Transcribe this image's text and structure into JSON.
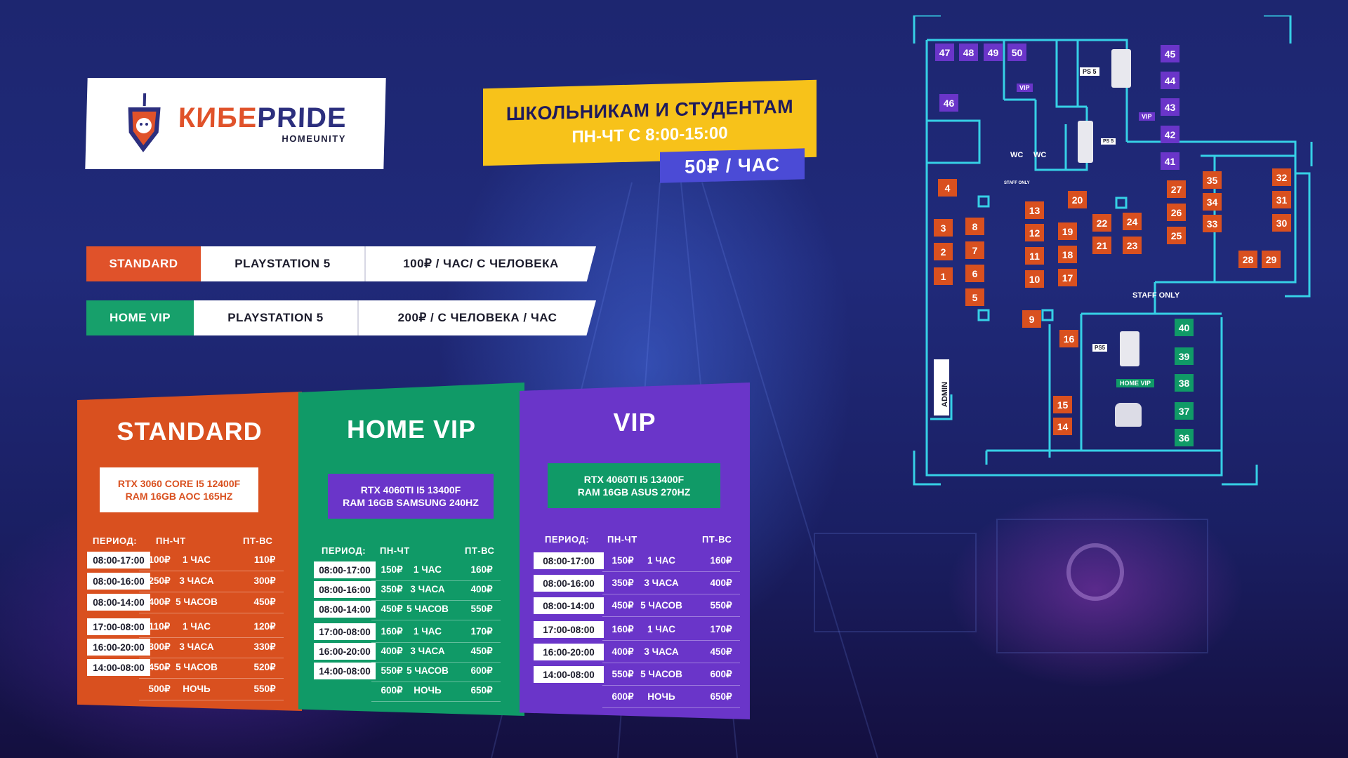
{
  "logo": {
    "name_part1": "КИБЕ",
    "name_part2": "PRIDE",
    "sub": "HOMEUNITY"
  },
  "promo": {
    "title": "ШКОЛЬНИКАМ И СТУДЕНТАМ",
    "subtitle": "ПН-ЧТ С 8:00-15:00",
    "price": "50₽ / ЧАС"
  },
  "playstation": [
    {
      "zone": "STANDARD",
      "device": "PLAYSTATION 5",
      "price": "100₽ / ЧАС/ С ЧЕЛОВЕКА",
      "color": "#e0522a"
    },
    {
      "zone": "HOME VIP",
      "device": "PLAYSTATION 5",
      "price": "200₽ / С ЧЕЛОВЕКА / ЧАС",
      "color": "#17a06b"
    }
  ],
  "headers": {
    "period": "ПЕРИОД:",
    "weekdays": "ПН-ЧТ",
    "weekend": "ПТ-ВС"
  },
  "panels": {
    "standard": {
      "title": "STANDARD",
      "spec1": "RTX 3060 CORE I5 12400F",
      "spec2": "RAM 16GB AOC 165HZ",
      "color": "#d9501f",
      "rows": [
        {
          "time": "08:00-17:00",
          "wd": "100₽",
          "dur": "1 ЧАС",
          "we": "110₽"
        },
        {
          "time": "08:00-16:00",
          "wd": "250₽",
          "dur": "3 ЧАСА",
          "we": "300₽"
        },
        {
          "time": "08:00-14:00",
          "wd": "400₽",
          "dur": "5 ЧАСОВ",
          "we": "450₽"
        },
        {
          "time": "17:00-08:00",
          "wd": "110₽",
          "dur": "1 ЧАС",
          "we": "120₽"
        },
        {
          "time": "16:00-20:00",
          "wd": "300₽",
          "dur": "3 ЧАСА",
          "we": "330₽"
        },
        {
          "time": "14:00-08:00",
          "wd": "450₽",
          "dur": "5 ЧАСОВ",
          "we": "520₽"
        },
        {
          "time": "",
          "wd": "500₽",
          "dur": "НОЧЬ",
          "we": "550₽"
        }
      ]
    },
    "homevip": {
      "title": "HOME VIP",
      "spec1": "RTX 4060TI I5 13400F",
      "spec2": "RAM 16GB SAMSUNG 240HZ",
      "color": "#109a67",
      "rows": [
        {
          "time": "08:00-17:00",
          "wd": "150₽",
          "dur": "1 ЧАС",
          "we": "160₽"
        },
        {
          "time": "08:00-16:00",
          "wd": "350₽",
          "dur": "3 ЧАСА",
          "we": "400₽"
        },
        {
          "time": "08:00-14:00",
          "wd": "450₽",
          "dur": "5 ЧАСОВ",
          "we": "550₽"
        },
        {
          "time": "17:00-08:00",
          "wd": "160₽",
          "dur": "1 ЧАС",
          "we": "170₽"
        },
        {
          "time": "16:00-20:00",
          "wd": "400₽",
          "dur": "3 ЧАСА",
          "we": "450₽"
        },
        {
          "time": "14:00-08:00",
          "wd": "550₽",
          "dur": "5 ЧАСОВ",
          "we": "600₽"
        },
        {
          "time": "",
          "wd": "600₽",
          "dur": "НОЧЬ",
          "we": "650₽"
        }
      ]
    },
    "vip": {
      "title": "VIP",
      "spec1": "RTX 4060TI I5 13400F",
      "spec2": "RAM 16GB ASUS 270HZ",
      "color": "#6a35c9",
      "rows": [
        {
          "time": "08:00-17:00",
          "wd": "150₽",
          "dur": "1 ЧАС",
          "we": "160₽"
        },
        {
          "time": "08:00-16:00",
          "wd": "350₽",
          "dur": "3 ЧАСА",
          "we": "400₽"
        },
        {
          "time": "08:00-14:00",
          "wd": "450₽",
          "dur": "5 ЧАСОВ",
          "we": "550₽"
        },
        {
          "time": "17:00-08:00",
          "wd": "160₽",
          "dur": "1 ЧАС",
          "we": "170₽"
        },
        {
          "time": "16:00-20:00",
          "wd": "400₽",
          "dur": "3 ЧАСА",
          "we": "450₽"
        },
        {
          "time": "14:00-08:00",
          "wd": "550₽",
          "dur": "5 ЧАСОВ",
          "we": "600₽"
        },
        {
          "time": "",
          "wd": "600₽",
          "dur": "НОЧЬ",
          "we": "650₽"
        }
      ]
    }
  },
  "map": {
    "labels": {
      "vip_a": "VIP",
      "vip_b": "VIP",
      "ps5_a": "PS 5",
      "ps5_b": "PS 5",
      "ps5_c": "PS5",
      "wc_a": "WC",
      "wc_b": "WC",
      "staff_small": "STAFF ONLY",
      "staff_big": "STAFF ONLY",
      "home_vip": "HOME VIP",
      "admin": "ADMIN"
    },
    "colors": {
      "orange": "#d9501f",
      "purple": "#6a35c9",
      "green": "#109a67",
      "wall": "#36d0e6"
    },
    "seats": {
      "s1": "1",
      "s2": "2",
      "s3": "3",
      "s4": "4",
      "s5": "5",
      "s6": "6",
      "s7": "7",
      "s8": "8",
      "s9": "9",
      "s10": "10",
      "s11": "11",
      "s12": "12",
      "s13": "13",
      "s14": "14",
      "s15": "15",
      "s16": "16",
      "s17": "17",
      "s18": "18",
      "s19": "19",
      "s20": "20",
      "s21": "21",
      "s22": "22",
      "s23": "23",
      "s24": "24",
      "s25": "25",
      "s26": "26",
      "s27": "27",
      "s28": "28",
      "s29": "29",
      "s30": "30",
      "s31": "31",
      "s32": "32",
      "s33": "33",
      "s34": "34",
      "s35": "35",
      "s36": "36",
      "s37": "37",
      "s38": "38",
      "s39": "39",
      "s40": "40",
      "s41": "41",
      "s42": "42",
      "s43": "43",
      "s44": "44",
      "s45": "45",
      "s46": "46",
      "s47": "47",
      "s48": "48",
      "s49": "49",
      "s50": "50"
    }
  }
}
